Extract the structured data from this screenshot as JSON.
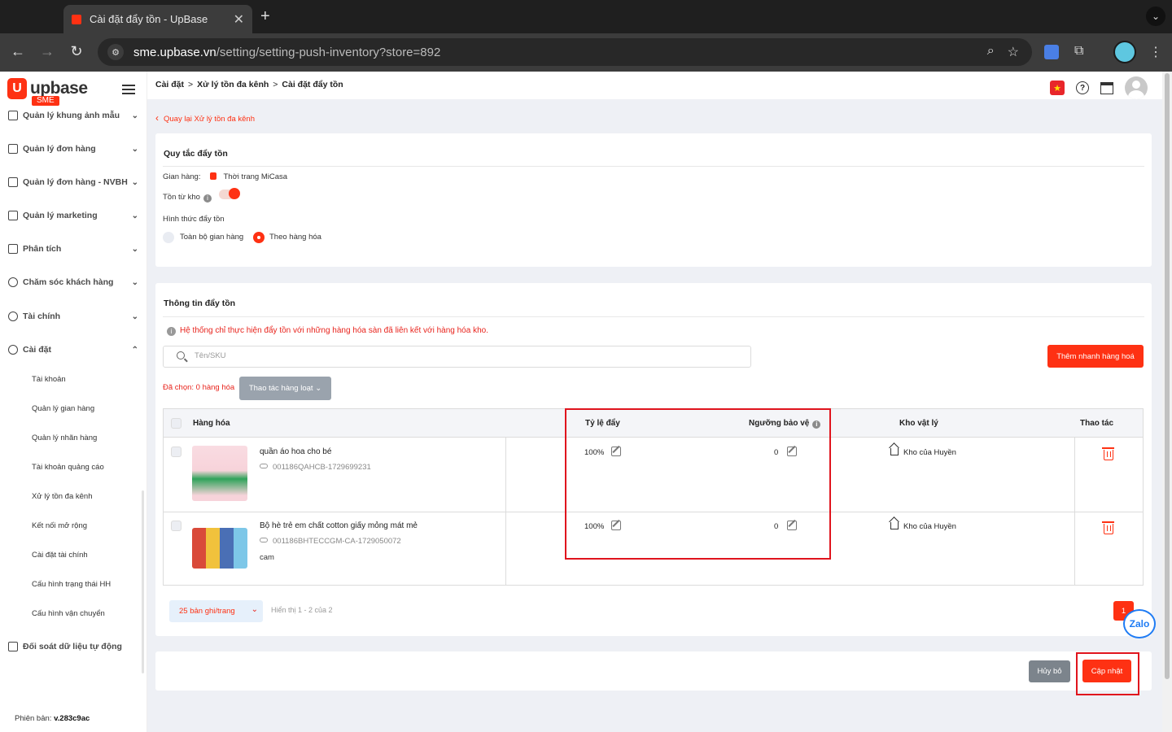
{
  "browser": {
    "tab_title": "Cài đặt đẩy tồn - UpBase",
    "url_host": "sme.upbase.vn",
    "url_path": "/setting/setting-push-inventory?store=892"
  },
  "brand": {
    "name": "upbase",
    "tag": "SME"
  },
  "sidebar": {
    "items": [
      {
        "label": "Quản lý khung ảnh mẫu"
      },
      {
        "label": "Quản lý đơn hàng"
      },
      {
        "label": "Quản lý đơn hàng - NVBH"
      },
      {
        "label": "Quản lý marketing"
      },
      {
        "label": "Phân tích"
      },
      {
        "label": "Chăm sóc khách hàng"
      },
      {
        "label": "Tài chính"
      },
      {
        "label": "Cài đặt"
      }
    ],
    "subitems": [
      {
        "label": "Tài khoản"
      },
      {
        "label": "Quản lý gian hàng"
      },
      {
        "label": "Quản lý nhãn hàng"
      },
      {
        "label": "Tài khoản quảng cáo"
      },
      {
        "label": "Xử lý tồn đa kênh"
      },
      {
        "label": "Kết nối mở rộng"
      },
      {
        "label": "Cài đặt tài chính"
      },
      {
        "label": "Cấu hình trạng thái HH"
      },
      {
        "label": "Cấu hình vận chuyển"
      }
    ],
    "auto_item": "Đối soát dữ liệu tự động",
    "version_label": "Phiên bản:",
    "version_value": "v.283c9ac"
  },
  "breadcrumb": {
    "c1": "Cài đặt",
    "c2": "Xử lý tồn đa kênh",
    "c3": "Cài đặt đẩy tồn",
    "sep": ">"
  },
  "back_link": "Quay lại Xử lý tồn đa kênh",
  "rules": {
    "title": "Quy tắc đẩy tồn",
    "shop_label": "Gian hàng:",
    "shop_name": "Thời trang MiCasa",
    "from_stock_label": "Tồn từ kho",
    "push_type_label": "Hình thức đẩy tồn",
    "option_all": "Toàn bộ gian hàng",
    "option_product": "Theo hàng hóa",
    "from_stock_enabled": true,
    "selected_option": "Theo hàng hóa"
  },
  "info": {
    "title": "Thông tin đẩy tồn",
    "warning": "Hệ thống chỉ thực hiện đẩy tồn với những hàng hóa sàn đã liên kết với hàng hóa kho.",
    "search_placeholder": "Tên/SKU",
    "quick_add": "Thêm nhanh hàng hoá",
    "selected_text": "Đã chọn: 0 hàng hóa",
    "bulk_action": "Thao tác hàng loạt"
  },
  "table": {
    "headers": {
      "product": "Hàng hóa",
      "ratio": "Tỷ lệ đẩy",
      "threshold": "Ngưỡng bảo vệ",
      "warehouse": "Kho vật lý",
      "actions": "Thao tác"
    },
    "rows": [
      {
        "name": "quần áo hoa cho bé",
        "sku": "001186QAHCB-1729699231",
        "variant": "",
        "ratio": "100%",
        "threshold": "0",
        "warehouse": "Kho của Huyền"
      },
      {
        "name": "Bộ hè trẻ em chất cotton giấy mỏng mát mẻ",
        "sku": "001186BHTECCGM-CA-1729050072",
        "variant": "cam",
        "ratio": "100%",
        "threshold": "0",
        "warehouse": "Kho của Huyền"
      }
    ]
  },
  "pagination": {
    "per_page": "25 bản ghi/trang",
    "info": "Hiển thị 1 - 2 của 2",
    "page": "1"
  },
  "footer": {
    "cancel": "Hủy bỏ",
    "update": "Cập nhật"
  },
  "zalo": "Zalo",
  "colors": {
    "accent": "#fe3113",
    "highlight": "#e0141d"
  }
}
